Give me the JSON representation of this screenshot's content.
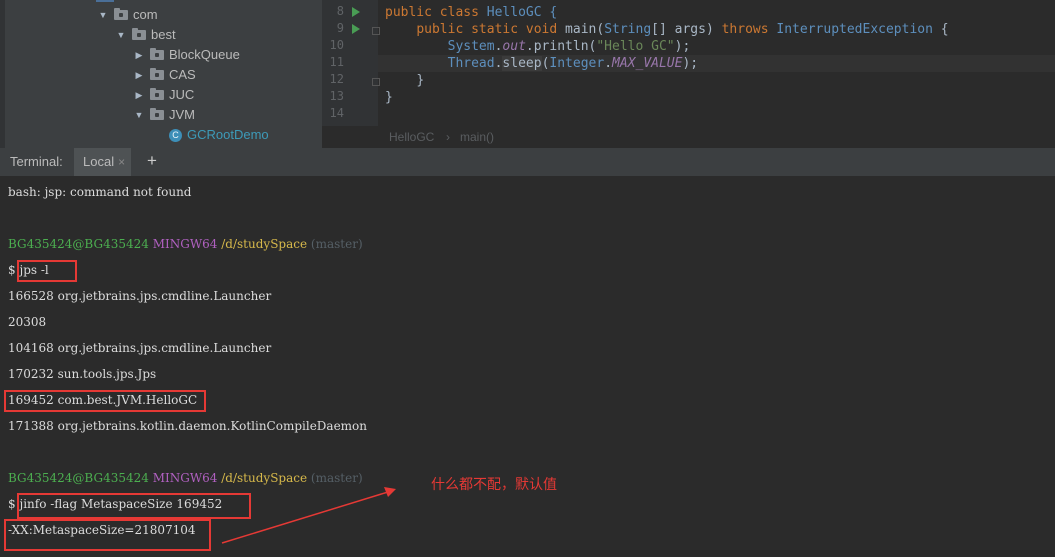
{
  "project_tree": {
    "items": [
      {
        "label": "com",
        "kind": "folder",
        "expanded": true
      },
      {
        "label": "best",
        "kind": "folder",
        "expanded": true
      },
      {
        "label": "BlockQueue",
        "kind": "folder",
        "expanded": false
      },
      {
        "label": "CAS",
        "kind": "folder",
        "expanded": false
      },
      {
        "label": "JUC",
        "kind": "folder",
        "expanded": false
      },
      {
        "label": "JVM",
        "kind": "folder",
        "expanded": true
      },
      {
        "label": "GCRootDemo",
        "kind": "class",
        "icon_letter": "C"
      }
    ]
  },
  "editor": {
    "line_numbers": [
      "8",
      "9",
      "10",
      "11",
      "12",
      "13",
      "14"
    ],
    "lines": {
      "l8_public": "public",
      "l8_class": "class",
      "l8_name": "HelloGC {",
      "l9_public": "public",
      "l9_static": "static",
      "l9_void": "void",
      "l9_main": "main(",
      "l9_string": "String",
      "l9_args": "[] args)",
      "l9_throws": "throws",
      "l9_exc": "InterruptedException",
      "l9_brace": "{",
      "l10_system": "System",
      "l10_dot1": ".",
      "l10_out": "out",
      "l10_println": ".println(",
      "l10_str": "\"Hello GC\"",
      "l10_end": ");",
      "l11_thread": "Thread",
      "l11_dot": ".",
      "l11_sleep": "sleep",
      "l11_open": "(",
      "l11_integer": "Integer",
      "l11_dot2": ".",
      "l11_max": "MAX_VALUE",
      "l11_end": ");",
      "l12": "}",
      "l13": "}"
    },
    "breadcrumb": [
      "HelloGC",
      "main()"
    ],
    "breadcrumb_sep": "›"
  },
  "terminal_tabs": {
    "title": "Terminal:",
    "active_tab": "Local",
    "close_glyph": "×",
    "add_glyph": "+"
  },
  "terminal": {
    "error_line": "bash: jsp: command not found",
    "prompt_user": "BG435424@BG435424",
    "prompt_env": "MINGW64",
    "prompt_path": "/d/studySpace",
    "prompt_branch": "(master)",
    "dollar": "$",
    "cmd1": "jps -l",
    "jps_output": [
      "166528 org.jetbrains.jps.cmdline.Launcher",
      "20308",
      "104168 org.jetbrains.jps.cmdline.Launcher",
      "170232 sun.tools.jps.Jps",
      "169452 com.best.JVM.HelloGC",
      "171388 org.jetbrains.kotlin.daemon.KotlinCompileDaemon"
    ],
    "cmd2": "jinfo -flag MetaspaceSize 169452",
    "result": "-XX:MetaspaceSize=21807104"
  },
  "annotation": {
    "text": "什么都不配，默认值",
    "color": "#e53935"
  },
  "colors": {
    "accent_red": "#e53935",
    "prompt_green": "#4caf50",
    "prompt_magenta": "#b060c0",
    "prompt_yellow": "#d7b94b",
    "keyword_orange": "#cc7832"
  }
}
